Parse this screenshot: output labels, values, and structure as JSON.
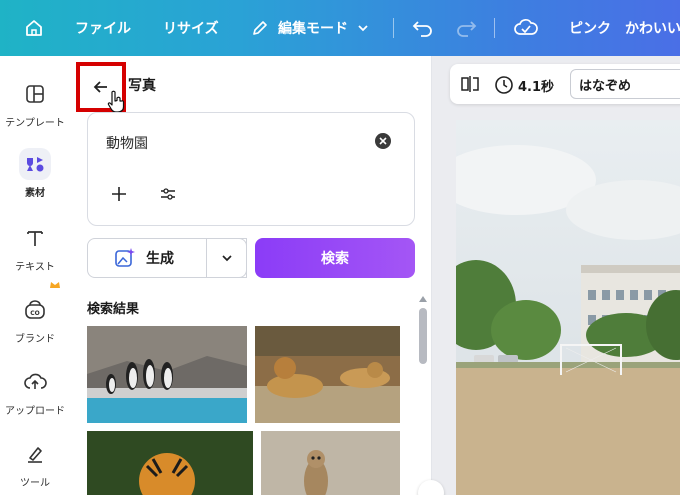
{
  "topbar": {
    "file_label": "ファイル",
    "resize_label": "リサイズ",
    "edit_mode_label": "編集モード",
    "design_name": "ピンク　かわいい"
  },
  "leftnav": {
    "items": [
      {
        "label": "テンプレート",
        "icon": "template-icon"
      },
      {
        "label": "素材",
        "icon": "elements-icon"
      },
      {
        "label": "テキスト",
        "icon": "text-icon"
      },
      {
        "label": "ブランド",
        "icon": "brand-icon"
      },
      {
        "label": "アップロード",
        "icon": "upload-icon"
      },
      {
        "label": "ツール",
        "icon": "tools-icon"
      }
    ]
  },
  "panel": {
    "title": "写真",
    "search_value": "動物園",
    "generate_label": "生成",
    "search_label": "検索",
    "results_title": "検索結果"
  },
  "canvas_toolbar": {
    "duration": "4.1秒",
    "font_name": "はなぞめ"
  },
  "colors": {
    "accent_purple": "#8b3cf7",
    "highlight_red": "#d50000",
    "topbar_start": "#1fb3c6",
    "topbar_end": "#4a6fe6"
  }
}
